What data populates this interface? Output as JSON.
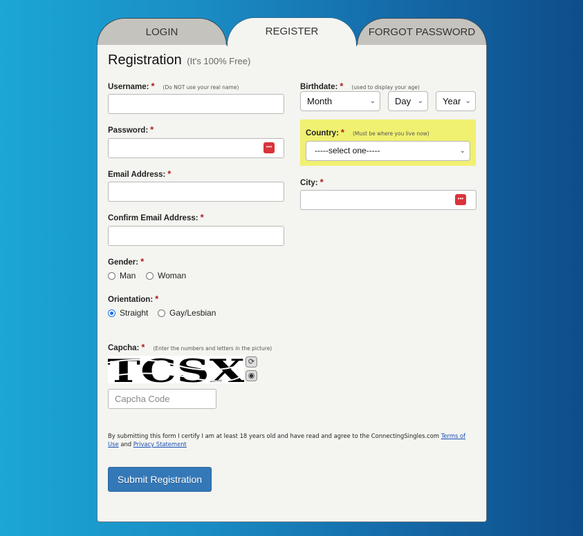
{
  "tabs": [
    {
      "label": "LOGIN",
      "active": false
    },
    {
      "label": "REGISTER",
      "active": true
    },
    {
      "label": "FORGOT PASSWORD",
      "active": false
    }
  ],
  "form": {
    "title": "Registration",
    "subtitle": "(It's 100% Free)",
    "required_mark": "*",
    "username": {
      "label": "Username:",
      "hint": "(Do NOT use your real name)",
      "value": ""
    },
    "password": {
      "label": "Password:",
      "value": ""
    },
    "email": {
      "label": "Email Address:",
      "value": ""
    },
    "confirm_email": {
      "label": "Confirm Email Address:",
      "value": ""
    },
    "birthdate": {
      "label": "Birthdate:",
      "hint": "(used to display your age)",
      "month": "Month",
      "day": "Day",
      "year": "Year"
    },
    "country": {
      "label": "Country:",
      "hint": "(Must be where you live now)",
      "selected": "-----select one-----"
    },
    "city": {
      "label": "City:",
      "value": ""
    },
    "gender": {
      "label": "Gender:",
      "options": [
        {
          "label": "Man",
          "checked": false
        },
        {
          "label": "Woman",
          "checked": false
        }
      ]
    },
    "orientation": {
      "label": "Orientation:",
      "options": [
        {
          "label": "Straight",
          "checked": true
        },
        {
          "label": "Gay/Lesbian",
          "checked": false
        }
      ]
    },
    "captcha": {
      "label": "Capcha:",
      "hint": "(Enter the numbers and letters in the picture)",
      "image_text": "TCSX",
      "placeholder": "Capcha Code",
      "refresh_icon": "refresh-icon",
      "audio_icon": "audio-icon"
    },
    "legal": {
      "text": "By submitting this form I certify I am at least 18 years old and have read and agree to the ConnectingSingles.com",
      "terms_link": "Terms of Use",
      "and": "and",
      "privacy_link": "Privacy Statement"
    },
    "submit_label": "Submit Registration",
    "password_manager_icon": "password-manager-icon"
  },
  "colors": {
    "accent": "#3478b8",
    "highlight": "#f0f071",
    "required": "#b01c1c"
  }
}
